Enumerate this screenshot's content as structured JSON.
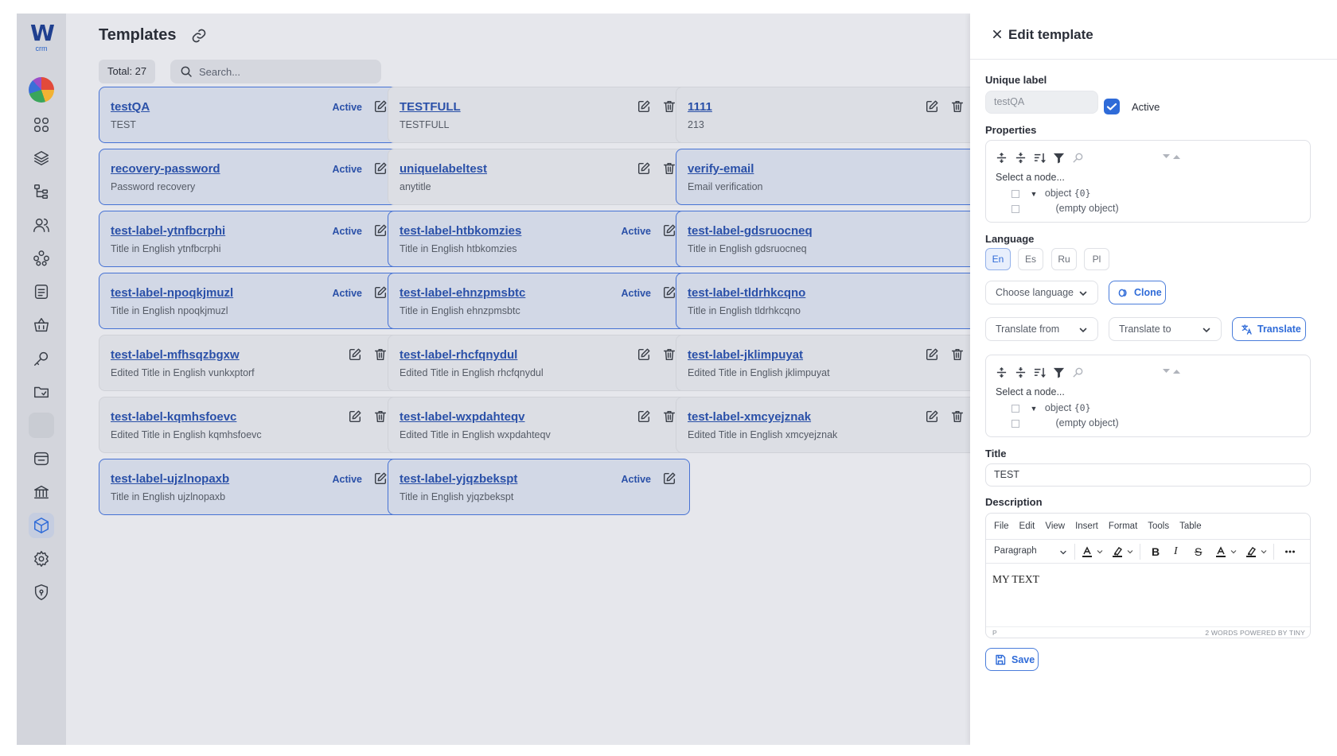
{
  "app": {
    "logo_letter": "W",
    "logo_sub": "crm"
  },
  "sidebar": {
    "items": [
      {
        "icon": "dashboard-grid-icon"
      },
      {
        "icon": "layers-icon"
      },
      {
        "icon": "hierarchy-icon"
      },
      {
        "icon": "users-icon"
      },
      {
        "icon": "network-icon"
      },
      {
        "icon": "notes-icon"
      },
      {
        "icon": "basket-icon"
      },
      {
        "icon": "key-icon"
      },
      {
        "icon": "folder-icon"
      },
      {
        "icon": "blank-icon"
      },
      {
        "icon": "device-icon"
      },
      {
        "icon": "bank-icon"
      },
      {
        "icon": "templates-cube-icon",
        "active": true
      },
      {
        "icon": "settings-icon"
      },
      {
        "icon": "shield-icon"
      }
    ]
  },
  "main": {
    "title": "Templates",
    "total": "Total: 27",
    "search_placeholder": "Search...",
    "cards": [
      {
        "name": "testQA",
        "sub": "TEST",
        "badge": "Active",
        "active": true
      },
      {
        "name": "TESTFULL",
        "sub": "TESTFULL",
        "badge": "",
        "active": false
      },
      {
        "name": "1111",
        "sub": "213",
        "badge": "",
        "active": false
      },
      {
        "name": "recovery-password",
        "sub": "Password recovery",
        "badge": "Active",
        "active": true
      },
      {
        "name": "uniquelabeltest",
        "sub": "anytitle",
        "badge": "",
        "active": false
      },
      {
        "name": "verify-email",
        "sub": "Email verification",
        "badge": "",
        "active": true
      },
      {
        "name": "test-label-ytnfbcrphi",
        "sub": "Title in English ytnfbcrphi",
        "badge": "Active",
        "active": true
      },
      {
        "name": "test-label-htbkomzies",
        "sub": "Title in English htbkomzies",
        "badge": "Active",
        "active": true
      },
      {
        "name": "test-label-gdsruocneq",
        "sub": "Title in English gdsruocneq",
        "badge": "",
        "active": true
      },
      {
        "name": "test-label-npoqkjmuzl",
        "sub": "Title in English npoqkjmuzl",
        "badge": "Active",
        "active": true
      },
      {
        "name": "test-label-ehnzpmsbtc",
        "sub": "Title in English ehnzpmsbtc",
        "badge": "Active",
        "active": true
      },
      {
        "name": "test-label-tldrhkcqno",
        "sub": "Title in English tldrhkcqno",
        "badge": "",
        "active": true
      },
      {
        "name": "test-label-mfhsqzbgxw",
        "sub": "Edited Title in English vunkxptorf",
        "badge": "",
        "active": false
      },
      {
        "name": "test-label-rhcfqnydul",
        "sub": "Edited Title in English rhcfqnydul",
        "badge": "",
        "active": false
      },
      {
        "name": "test-label-jklimpuyat",
        "sub": "Edited Title in English jklimpuyat",
        "badge": "",
        "active": false
      },
      {
        "name": "test-label-kqmhsfoevc",
        "sub": "Edited Title in English kqmhsfoevc",
        "badge": "",
        "active": false
      },
      {
        "name": "test-label-wxpdahteqv",
        "sub": "Edited Title in English wxpdahteqv",
        "badge": "",
        "active": false
      },
      {
        "name": "test-label-xmcyejznak",
        "sub": "Edited Title in English xmcyejznak",
        "badge": "",
        "active": false
      },
      {
        "name": "test-label-ujzlnopaxb",
        "sub": "Title in English ujzlnopaxb",
        "badge": "Active",
        "active": true
      },
      {
        "name": "test-label-yjqzbekspt",
        "sub": "Title in English yjqzbekspt",
        "badge": "Active",
        "active": true
      }
    ]
  },
  "panel": {
    "title": "Edit template",
    "unique_label_label": "Unique label",
    "unique_label_value": "testQA",
    "active_label": "Active",
    "properties_label": "Properties",
    "json_select_node": "Select a node...",
    "json_object": "object",
    "json_count": "{0}",
    "json_empty": "(empty object)",
    "language_label": "Language",
    "languages": [
      "En",
      "Es",
      "Ru",
      "Pl"
    ],
    "selected_language": "En",
    "choose_language": "Choose language",
    "clone": "Clone",
    "translate_from": "Translate from",
    "translate_to": "Translate to",
    "translate": "Translate",
    "title_label": "Title",
    "title_value": "TEST",
    "description_label": "Description",
    "menu": [
      "File",
      "Edit",
      "View",
      "Insert",
      "Format",
      "Tools",
      "Table"
    ],
    "block_format": "Paragraph",
    "body_text": "MY TEXT",
    "status_path": "P",
    "status_right": "2 WORDS  POWERED BY TINY",
    "save": "Save"
  },
  "colors": {
    "accent": "#2f6bd8",
    "link": "#2a50a8",
    "overlay_bg": "#e6e7ec"
  }
}
